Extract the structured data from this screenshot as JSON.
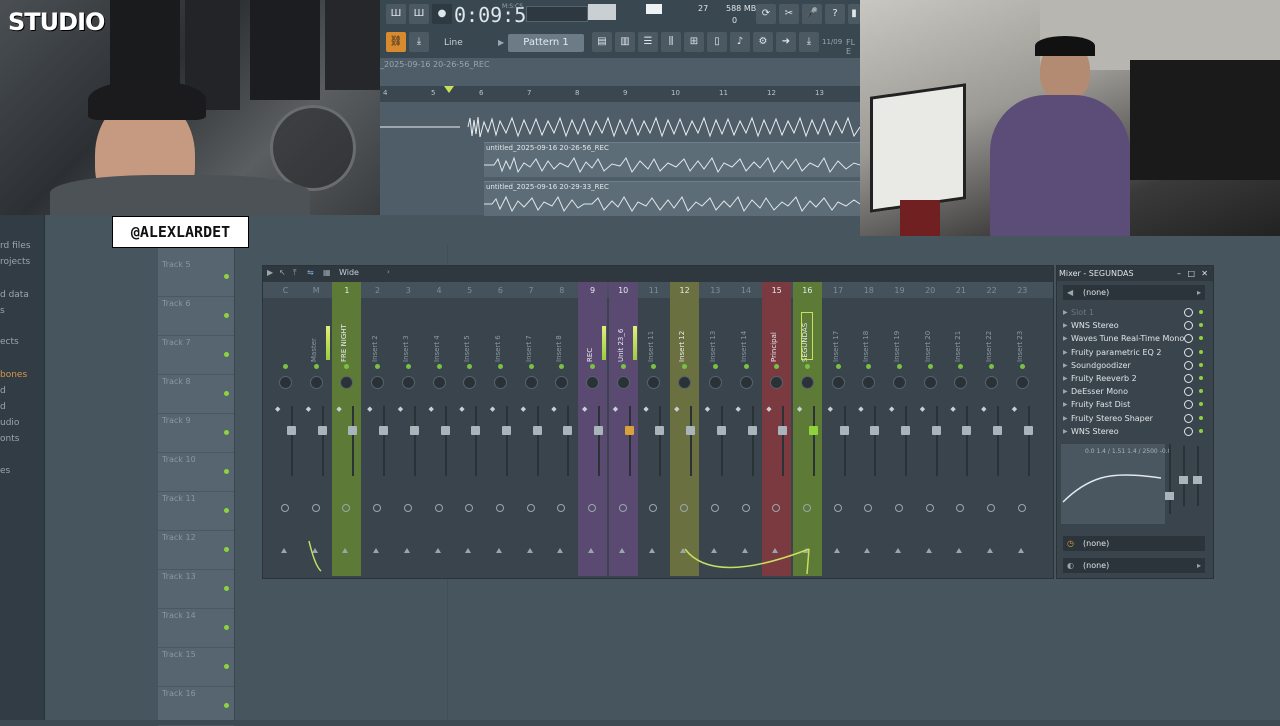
{
  "overlay": {
    "studio_logo": "STUDIO",
    "handle": "@ALEXLARDET"
  },
  "browser": {
    "items": [
      {
        "label": "rd files",
        "color": "normal"
      },
      {
        "label": "rojects",
        "color": "normal"
      },
      {
        "label": "d data",
        "color": "normal"
      },
      {
        "label": "s",
        "color": "normal"
      },
      {
        "label": "ects",
        "color": "normal"
      },
      {
        "label": "bones",
        "color": "orange"
      },
      {
        "label": "d",
        "color": "normal"
      },
      {
        "label": "d",
        "color": "normal"
      },
      {
        "label": "udio",
        "color": "normal"
      },
      {
        "label": "onts",
        "color": "normal"
      },
      {
        "label": "es",
        "color": "normal"
      }
    ]
  },
  "toolbar": {
    "time": "0:09:54",
    "time_unit": "M:S:CS",
    "cpu": "27",
    "memory": "588 MB",
    "memory_zero": "0",
    "snap_mode": "Line",
    "pattern": "Pattern 1",
    "bar_position": "11/09",
    "fl_label": "FL E"
  },
  "playlist": {
    "clip_name": "_2025-09-16 20-26-56_REC",
    "ruler": [
      "4",
      "5",
      "6",
      "7",
      "8",
      "9",
      "10",
      "11",
      "12",
      "13"
    ],
    "clips": [
      "untitled_2025-09-16 20-26-56_REC",
      "untitled_2025-09-16 20-29-33_REC"
    ],
    "tracks": [
      "Track 5",
      "Track 6",
      "Track 7",
      "Track 8",
      "Track 9",
      "Track 10",
      "Track 11",
      "Track 12",
      "Track 13",
      "Track 14",
      "Track 15",
      "Track 16"
    ]
  },
  "mixer": {
    "view": "Wide",
    "channels": [
      {
        "num": "C",
        "name": ""
      },
      {
        "num": "M",
        "name": "Master"
      },
      {
        "num": "1",
        "name": "FRE NIGHT"
      },
      {
        "num": "2",
        "name": "Insert 2"
      },
      {
        "num": "3",
        "name": "Insert 3"
      },
      {
        "num": "4",
        "name": "Insert 4"
      },
      {
        "num": "5",
        "name": "Insert 5"
      },
      {
        "num": "6",
        "name": "Insert 6"
      },
      {
        "num": "7",
        "name": "Insert 7"
      },
      {
        "num": "8",
        "name": "Insert 8"
      },
      {
        "num": "9",
        "name": "REC"
      },
      {
        "num": "10",
        "name": "Unit 23_6"
      },
      {
        "num": "11",
        "name": "Insert 11"
      },
      {
        "num": "12",
        "name": "Insert 12"
      },
      {
        "num": "13",
        "name": "Insert 13"
      },
      {
        "num": "14",
        "name": "Insert 14"
      },
      {
        "num": "15",
        "name": "Principal"
      },
      {
        "num": "16",
        "name": "SEGUNDAS"
      },
      {
        "num": "17",
        "name": "Insert 17"
      },
      {
        "num": "18",
        "name": "Insert 18"
      },
      {
        "num": "19",
        "name": "Insert 19"
      },
      {
        "num": "20",
        "name": "Insert 20"
      },
      {
        "num": "21",
        "name": "Insert 21"
      },
      {
        "num": "22",
        "name": "Insert 22"
      },
      {
        "num": "23",
        "name": "Insert 23"
      }
    ]
  },
  "fx_panel": {
    "title": "Mixer - SEGUNDAS",
    "input": "(none)",
    "slots": [
      "Slot 1",
      "WNS Stereo",
      "Waves Tune Real-Time Mono",
      "Fruity parametric EQ 2",
      "Soundgoodizer",
      "Fruity Reeverb 2",
      "DeEsser Mono",
      "Fruity Fast Dist",
      "Fruity Stereo Shaper",
      "WNS Stereo"
    ],
    "eq_label": "0.0 1.4 / 1.51 1.4 / 2500 -0.0",
    "output_1": "(none)",
    "output_2": "(none)"
  },
  "colors": {
    "accent_green": "#8ed23d",
    "purple_ch": "#5a4a72",
    "green_ch": "#5d7a36",
    "red_ch": "#7a3a3f",
    "yellow_ch": "#6b7040"
  }
}
